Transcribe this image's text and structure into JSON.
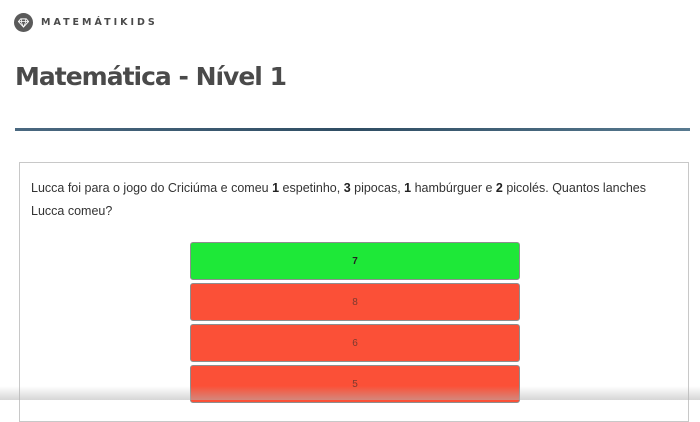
{
  "brand": {
    "name": "MATEMÁTIKIDS",
    "icon": "diamond-icon"
  },
  "page": {
    "title": "Matemática - Nível 1"
  },
  "question": {
    "parts": [
      "Lucca foi para o jogo do Criciúma e comeu ",
      "1",
      " espetinho, ",
      "3",
      " pipocas, ",
      "1",
      " hambúrguer e ",
      "2",
      " picolés. Quantos lanches Lucca comeu?"
    ]
  },
  "answers": [
    {
      "label": "7",
      "state": "correct"
    },
    {
      "label": "8",
      "state": "wrong"
    },
    {
      "label": "6",
      "state": "wrong"
    },
    {
      "label": "5",
      "state": "wrong"
    }
  ],
  "colors": {
    "correct": "#1ee838",
    "wrong": "#fb5037",
    "divider": "#2f4d63",
    "logo": "#5a5a5a"
  }
}
